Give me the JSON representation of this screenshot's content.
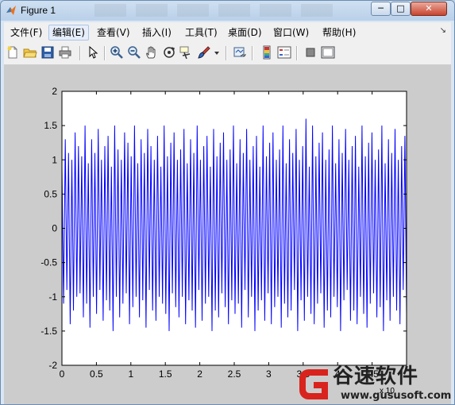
{
  "window": {
    "title": "Figure 1",
    "min_glyph": "─",
    "max_glyph": "□",
    "close_glyph": "✕"
  },
  "menu": {
    "items": [
      "文件(F)",
      "编辑(E)",
      "查看(V)",
      "插入(I)",
      "工具(T)",
      "桌面(D)",
      "窗口(W)",
      "帮助(H)"
    ],
    "active_index": 1,
    "overflow_glyph": "↘"
  },
  "toolbar": {
    "icons": [
      "new-figure-icon",
      "open-file-icon",
      "save-icon",
      "print-icon",
      "edit-plot-arrow-icon",
      "zoom-in-icon",
      "zoom-out-icon",
      "pan-hand-icon",
      "rotate-3d-icon",
      "data-cursor-icon",
      "brush-icon",
      "brush-dropdown-icon",
      "link-plot-icon",
      "insert-colorbar-icon",
      "insert-legend-icon",
      "hide-plot-tools-icon",
      "show-plot-tools-icon"
    ]
  },
  "watermark": {
    "brand": "谷速软件",
    "url": "www.gususoft.com"
  },
  "chart_data": {
    "type": "line",
    "title": "",
    "xlabel": "",
    "ylabel": "",
    "xlim": [
      0,
      5
    ],
    "ylim": [
      -2,
      2
    ],
    "x_ticks": [
      "0",
      "0.5",
      "1",
      "1.5",
      "2",
      "2.5",
      "3",
      "3.5",
      "4",
      "4.5"
    ],
    "y_ticks": [
      "2",
      "1.5",
      "1",
      "0.5",
      "0",
      "-0.5",
      "-1",
      "-1.5",
      "-2"
    ],
    "x_exponent_label": "x 10",
    "grid": false,
    "series": [
      {
        "color": "#0000ff",
        "description_levels": [
          -1.5,
          -1,
          1,
          1.5
        ],
        "values": [
          0.9,
          -1.1,
          1.3,
          -0.9,
          1.1,
          -1.4,
          1.0,
          -1.2,
          1.4,
          -1.0,
          1.2,
          -0.95,
          1.05,
          -1.3,
          1.5,
          -1.1,
          0.95,
          -1.45,
          1.3,
          -1.0,
          1.1,
          -1.25,
          1.45,
          -0.9,
          1.0,
          -1.35,
          1.2,
          -1.05,
          1.35,
          -1.2,
          0.9,
          -1.5,
          1.5,
          -1.0,
          1.15,
          -1.3,
          1.0,
          -1.1,
          1.4,
          -0.95,
          1.25,
          -1.4,
          1.05,
          -1.15,
          1.5,
          -1.0,
          0.95,
          -1.3,
          1.3,
          -1.05,
          1.1,
          -1.45,
          1.45,
          -0.9,
          1.2,
          -1.2,
          1.0,
          -1.35,
          1.35,
          -1.0,
          0.9,
          -1.1,
          1.5,
          -1.25,
          1.05,
          -1.5,
          1.25,
          -0.95,
          1.4,
          -1.15,
          1.0,
          -1.3,
          1.15,
          -1.0,
          1.45,
          -1.4,
          0.95,
          -1.05,
          1.3,
          -1.2,
          1.1,
          -1.45,
          1.5,
          -0.9,
          1.0,
          -1.35,
          1.2,
          -1.1,
          1.35,
          -1.0,
          0.9,
          -1.5,
          1.45,
          -1.2,
          1.05,
          -1.3,
          1.25,
          -0.95,
          1.4,
          -1.15,
          1.0,
          -1.4,
          1.15,
          -1.05,
          1.5,
          -1.25,
          0.95,
          -1.1,
          1.3,
          -1.45,
          1.1,
          -0.9,
          1.45,
          -1.3,
          1.0,
          -1.0,
          1.2,
          -1.5,
          1.35,
          -1.2,
          0.9,
          -1.05,
          1.5,
          -1.35,
          1.05,
          -0.95,
          1.25,
          -1.4,
          1.4,
          -1.15,
          1.0,
          -1.0,
          1.15,
          -1.45,
          1.5,
          -1.1,
          0.95,
          -1.3,
          1.3,
          -1.2,
          1.1,
          -0.9,
          1.45,
          -1.5,
          1.0,
          -1.05,
          1.2,
          -1.35,
          1.6,
          -1.0,
          0.9,
          -1.25,
          1.5,
          -1.4,
          1.05,
          -1.1,
          1.25,
          -0.95,
          1.4,
          -1.45,
          1.0,
          -1.2,
          1.15,
          -1.3,
          1.5,
          -1.0,
          0.95,
          -1.15,
          1.3,
          -1.5,
          1.1,
          -1.05,
          1.45,
          -0.9,
          1.0,
          -1.35,
          1.2,
          -1.2,
          1.35,
          -1.4,
          0.9,
          -1.0,
          1.5,
          -1.25,
          1.05,
          -1.45,
          1.25,
          -1.1,
          1.4,
          -0.95,
          1.0,
          -1.3,
          1.15,
          -1.15,
          1.5,
          -1.5,
          0.95,
          -1.05,
          1.3,
          -1.35,
          1.1,
          -1.0,
          1.45,
          -1.2,
          1.0,
          -1.4,
          1.2,
          -0.9,
          1.35,
          -1.25
        ]
      }
    ]
  }
}
